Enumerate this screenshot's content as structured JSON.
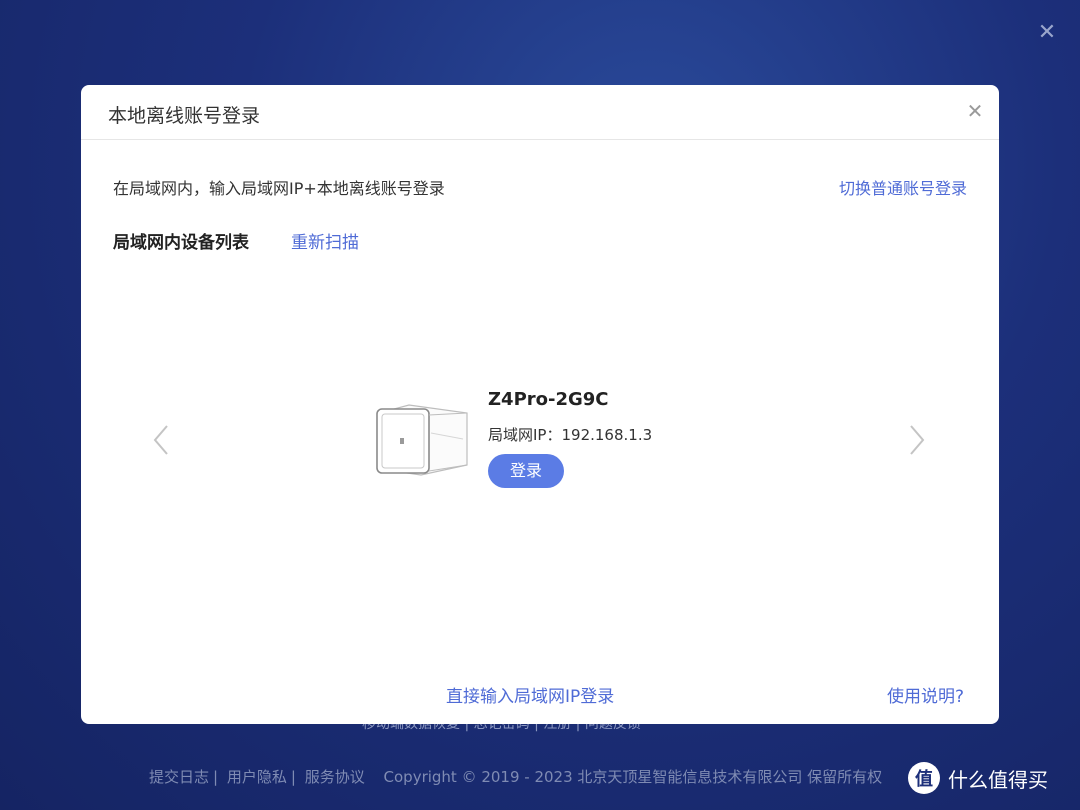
{
  "background": {
    "close_icon": "close-icon",
    "links_text": "移动端数据恢复  |  忘记密码  |  注册  |  问题反馈",
    "footer": {
      "log": "提交日志",
      "privacy": "用户隐私",
      "service": "服务协议",
      "copyright": "Copyright © 2019 - 2023 北京天顶星智能信息技术有限公司 保留所有权"
    },
    "watermark": {
      "logo_char": "值",
      "text": "什么值得买"
    }
  },
  "dialog": {
    "title": "本地离线账号登录",
    "description": "在局域网内，输入局域网IP+本地离线账号登录",
    "switch_link": "切换普通账号登录",
    "list_title": "局域网内设备列表",
    "rescan": "重新扫描",
    "device": {
      "name": "Z4Pro-2G9C",
      "ip_label": "局域网IP：",
      "ip_value": "192.168.1.3",
      "login_button": "登录"
    },
    "direct_login_link": "直接输入局域网IP登录",
    "help_link": "使用说明?"
  },
  "colors": {
    "accent": "#4f6bd6",
    "button": "#5b7ce5",
    "background_dark": "#152463"
  }
}
